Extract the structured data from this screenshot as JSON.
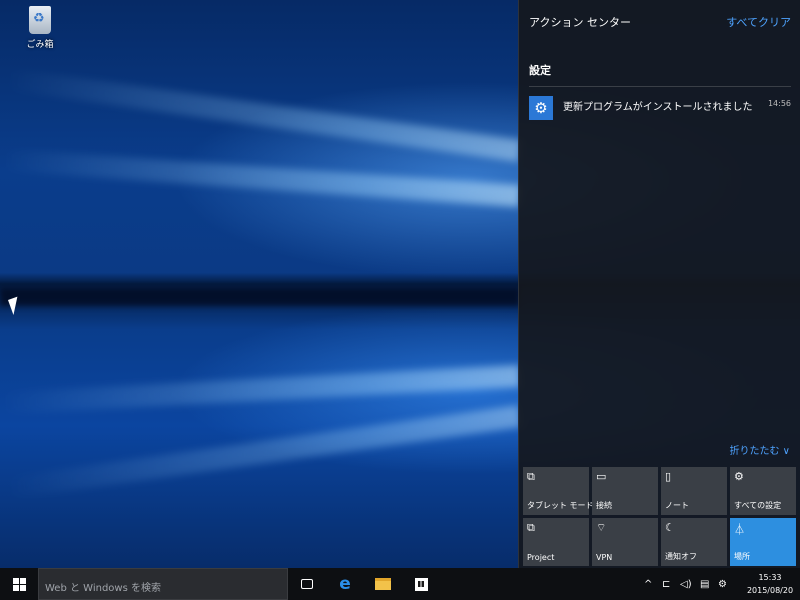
{
  "desktop": {
    "recycle_bin_label": "ごみ箱"
  },
  "action_center": {
    "title": "アクション センター",
    "clear_all": "すべてクリア",
    "section": "設定",
    "notification": {
      "icon": "gear-icon",
      "text": "更新プログラムがインストールされました",
      "time": "14:56"
    },
    "collapse_label": "折りたたむ ∨",
    "tiles": [
      {
        "label": "タブレット モード",
        "icon": "tablet-mode-icon",
        "glyph": "⧉",
        "active": false
      },
      {
        "label": "接続",
        "icon": "connect-icon",
        "glyph": "▭",
        "active": false
      },
      {
        "label": "ノート",
        "icon": "note-icon",
        "glyph": "▯",
        "active": false
      },
      {
        "label": "すべての設定",
        "icon": "settings-icon",
        "glyph": "⚙",
        "active": false
      },
      {
        "label": "Project",
        "icon": "project-icon",
        "glyph": "⧉",
        "active": false
      },
      {
        "label": "VPN",
        "icon": "vpn-icon",
        "glyph": "⌔",
        "active": false
      },
      {
        "label": "通知オフ",
        "icon": "quiet-hours-icon",
        "glyph": "☾",
        "active": false
      },
      {
        "label": "場所",
        "icon": "location-icon",
        "glyph": "⏃",
        "active": true
      }
    ]
  },
  "taskbar": {
    "search_placeholder": "Web と Windows を検索",
    "tray_caret": "^",
    "time": "15:33",
    "date": "2015/08/20"
  },
  "colors": {
    "accent": "#2d8fe0",
    "link": "#4ea3ff"
  }
}
